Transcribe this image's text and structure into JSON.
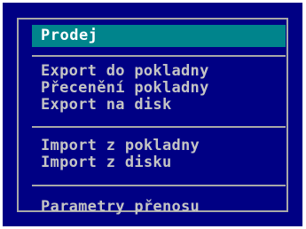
{
  "menu": {
    "title": "Prodej",
    "groups": [
      {
        "items": [
          "Export do pokladny",
          "Přecenění pokladny",
          "Export na disk"
        ]
      },
      {
        "items": [
          "Import z pokladny",
          "Import z disku"
        ]
      },
      {
        "items": [
          "Parametry přenosu"
        ]
      }
    ]
  },
  "colors": {
    "background": "#000084",
    "title_bar": "#00848c",
    "text": "#c4c4c4",
    "border": "#a8a8a8"
  }
}
